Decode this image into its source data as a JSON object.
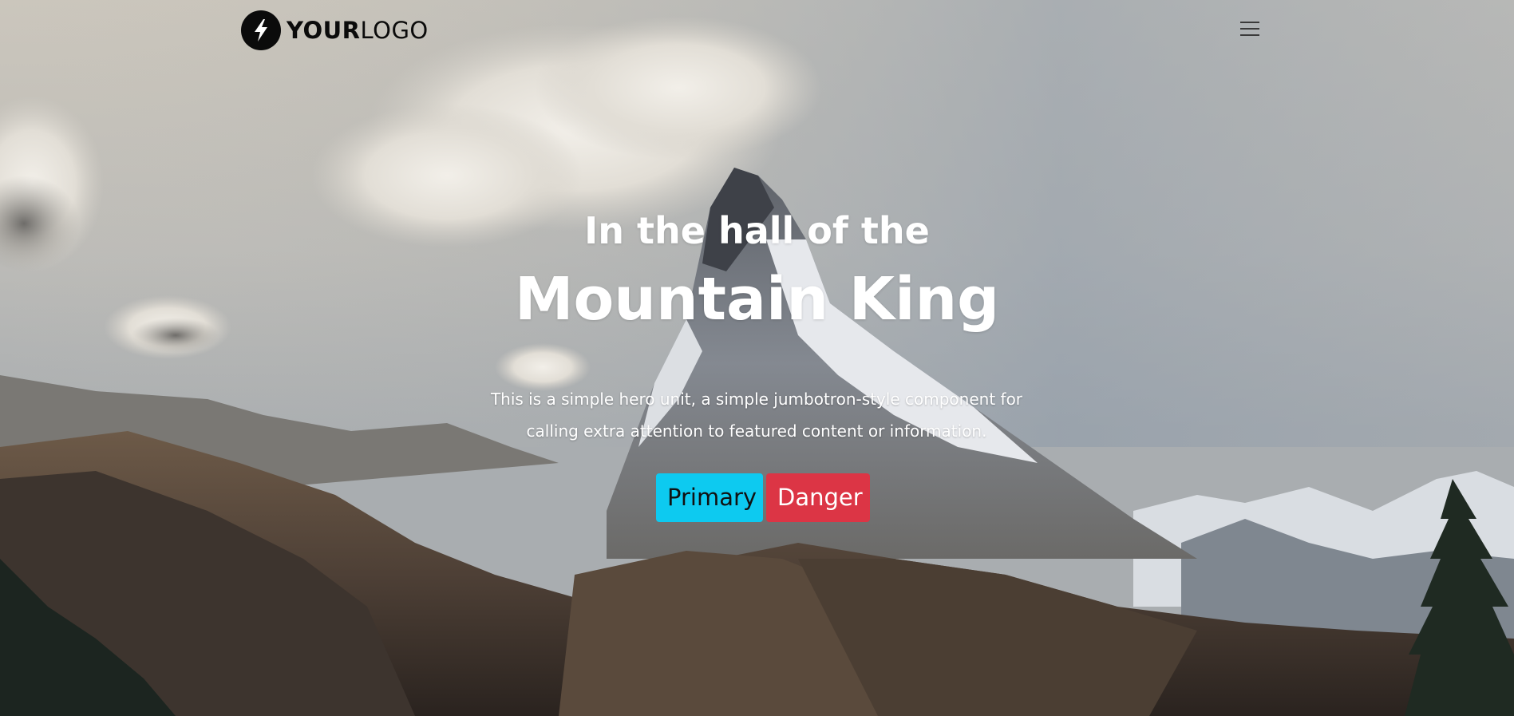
{
  "logo": {
    "bold_text": "YOUR",
    "light_text": "LOGO",
    "icon": "lightning-bolt-icon"
  },
  "nav": {
    "menu_icon": "hamburger-menu-icon"
  },
  "hero": {
    "pre_title": "In the hall of the",
    "title": "Mountain King",
    "lead_line1": "This is a simple hero unit, a simple jumbotron-style component for",
    "lead_line2": "calling extra attention to featured content or information.",
    "background_image": "snow-capped-mountain-peak"
  },
  "buttons": {
    "primary_label": "Primary",
    "danger_label": "Danger"
  },
  "colors": {
    "primary": "#0dcaf0",
    "danger": "#dc3545",
    "text_light": "#ffffff",
    "logo": "#0b0b0b"
  }
}
